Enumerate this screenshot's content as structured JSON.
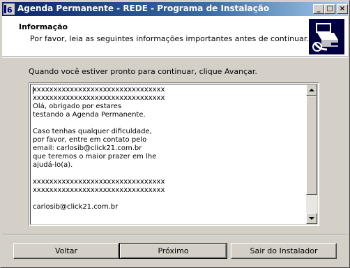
{
  "window": {
    "title": "Agenda Permanente - REDE - Programa de Instalação",
    "controls": {
      "minimize": "_",
      "maximize": "□",
      "close": "×"
    }
  },
  "header": {
    "title": "Informação",
    "subtitle": "Por favor, leia as seguintes informações importantes antes de continuar."
  },
  "main": {
    "prompt": "Quando você estiver pronto para continuar, clique Avançar.",
    "info_lines": [
      "xxxxxxxxxxxxxxxxxxxxxxxxxxxxxxxx",
      "xxxxxxxxxxxxxxxxxxxxxxxxxxxxxxxx",
      "Olá, obrigado por estares",
      "testando a Agenda Permanente.",
      "",
      "Caso tenhas qualquer dificuldade,",
      "por favor, entre em contato pelo",
      "email: carlosib@click21.com.br",
      "que teremos o maior prazer em lhe",
      "ajudá-lo(a).",
      "",
      "xxxxxxxxxxxxxxxxxxxxxxxxxxxxxxxx",
      "xxxxxxxxxxxxxxxxxxxxxxxxxxxxxxxx",
      "",
      "carlosib@click21.com.br"
    ],
    "scroll_position": 0
  },
  "buttons": {
    "back": "Voltar",
    "next": "Próximo",
    "cancel": "Sair do Instalador"
  },
  "icons": {
    "app": "installer-app-icon",
    "header": "computer-disk-icon"
  }
}
